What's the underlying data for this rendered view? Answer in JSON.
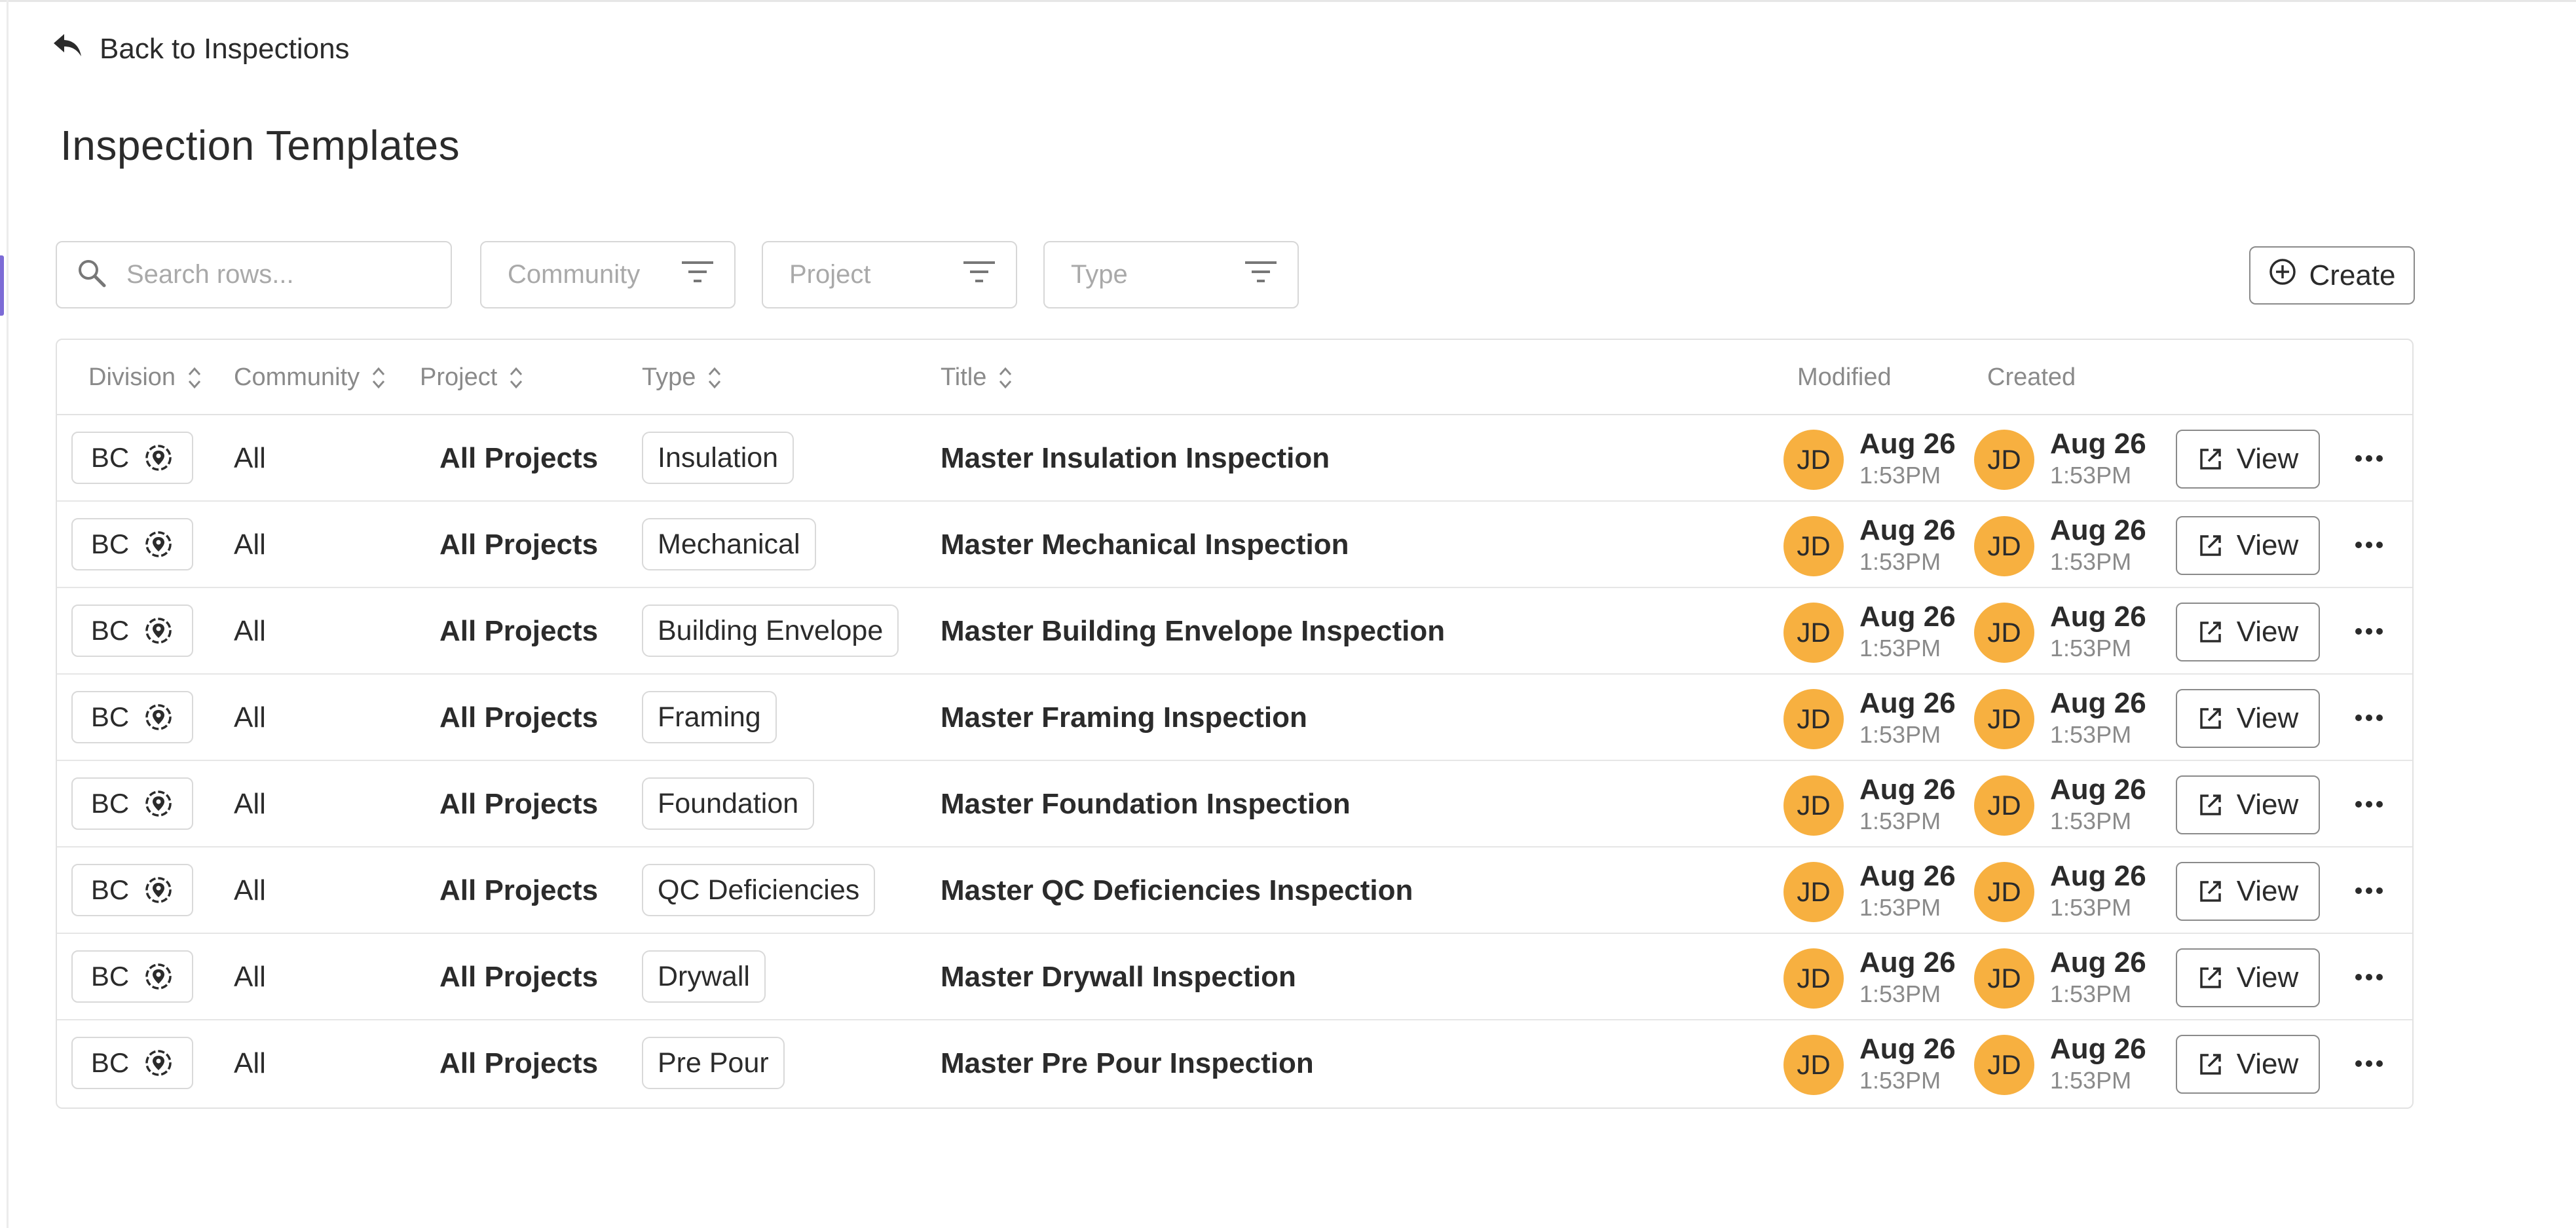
{
  "nav": {
    "back_label": "Back to Inspections"
  },
  "page": {
    "title": "Inspection Templates"
  },
  "toolbar": {
    "search_placeholder": "Search rows...",
    "filters": [
      {
        "label": "Community"
      },
      {
        "label": "Project"
      },
      {
        "label": "Type"
      }
    ],
    "create_label": "Create"
  },
  "table": {
    "columns": {
      "division": "Division",
      "community": "Community",
      "project": "Project",
      "type": "Type",
      "title": "Title",
      "modified": "Modified",
      "created": "Created"
    },
    "view_label": "View",
    "rows": [
      {
        "division": "BC",
        "community": "All",
        "project": "All Projects",
        "type": "Insulation",
        "title": "Master Insulation Inspection",
        "modified_initials": "JD",
        "modified_date": "Aug 26",
        "modified_time": "1:53PM",
        "created_initials": "JD",
        "created_date": "Aug 26",
        "created_time": "1:53PM"
      },
      {
        "division": "BC",
        "community": "All",
        "project": "All Projects",
        "type": "Mechanical",
        "title": "Master Mechanical Inspection",
        "modified_initials": "JD",
        "modified_date": "Aug 26",
        "modified_time": "1:53PM",
        "created_initials": "JD",
        "created_date": "Aug 26",
        "created_time": "1:53PM"
      },
      {
        "division": "BC",
        "community": "All",
        "project": "All Projects",
        "type": "Building Envelope",
        "title": "Master Building Envelope Inspection",
        "modified_initials": "JD",
        "modified_date": "Aug 26",
        "modified_time": "1:53PM",
        "created_initials": "JD",
        "created_date": "Aug 26",
        "created_time": "1:53PM"
      },
      {
        "division": "BC",
        "community": "All",
        "project": "All Projects",
        "type": "Framing",
        "title": "Master Framing Inspection",
        "modified_initials": "JD",
        "modified_date": "Aug 26",
        "modified_time": "1:53PM",
        "created_initials": "JD",
        "created_date": "Aug 26",
        "created_time": "1:53PM"
      },
      {
        "division": "BC",
        "community": "All",
        "project": "All Projects",
        "type": "Foundation",
        "title": "Master Foundation Inspection",
        "modified_initials": "JD",
        "modified_date": "Aug 26",
        "modified_time": "1:53PM",
        "created_initials": "JD",
        "created_date": "Aug 26",
        "created_time": "1:53PM"
      },
      {
        "division": "BC",
        "community": "All",
        "project": "All Projects",
        "type": "QC Deficiencies",
        "title": "Master QC Deficiencies Inspection",
        "modified_initials": "JD",
        "modified_date": "Aug 26",
        "modified_time": "1:53PM",
        "created_initials": "JD",
        "created_date": "Aug 26",
        "created_time": "1:53PM"
      },
      {
        "division": "BC",
        "community": "All",
        "project": "All Projects",
        "type": "Drywall",
        "title": "Master Drywall Inspection",
        "modified_initials": "JD",
        "modified_date": "Aug 26",
        "modified_time": "1:53PM",
        "created_initials": "JD",
        "created_date": "Aug 26",
        "created_time": "1:53PM"
      },
      {
        "division": "BC",
        "community": "All",
        "project": "All Projects",
        "type": "Pre Pour",
        "title": "Master Pre Pour Inspection",
        "modified_initials": "JD",
        "modified_date": "Aug 26",
        "modified_time": "1:53PM",
        "created_initials": "JD",
        "created_date": "Aug 26",
        "created_time": "1:53PM"
      }
    ]
  },
  "colors": {
    "avatar": "#f7b040",
    "accent": "#7c6bd6",
    "border": "#d7d7d7",
    "muted_text": "#8a8a8a"
  },
  "icons": {
    "back": "reply-arrow-icon",
    "search": "search-icon",
    "filter": "filter-lines-icon",
    "create": "plus-circle-icon",
    "sort": "sort-chevrons-icon",
    "division": "location-target-icon",
    "view": "external-link-icon",
    "more": "more-horizontal-icon"
  }
}
